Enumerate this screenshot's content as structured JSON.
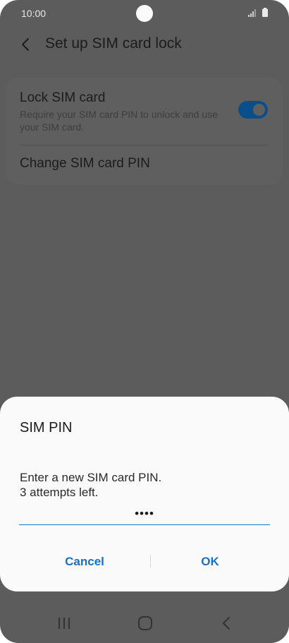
{
  "status_bar": {
    "time": "10:00",
    "icons": [
      "camera-hole",
      "signal-icon",
      "battery-icon"
    ]
  },
  "app_bar": {
    "title": "Set up SIM card lock",
    "back_icon": "chevron-left-icon"
  },
  "settings": {
    "lock_sim": {
      "title": "Lock SIM card",
      "subtitle": "Require your SIM card PIN to unlock and use your SIM card.",
      "toggle_on": true
    },
    "change_pin": {
      "title": "Change SIM card PIN"
    }
  },
  "dialog": {
    "title": "SIM PIN",
    "message_line1": "Enter a new SIM card PIN.",
    "message_line2": "3 attempts left.",
    "pin_value": "••••",
    "cancel_label": "Cancel",
    "ok_label": "OK"
  },
  "nav_bar": {
    "items": [
      "recents-icon",
      "home-icon",
      "back-icon"
    ]
  },
  "colors": {
    "accent": "#1a6fc0",
    "underline": "#0c7ad3",
    "dim_background": "#5c5c5c",
    "dialog_background": "#fafafa",
    "toggle_track": "#0a4f8a"
  }
}
